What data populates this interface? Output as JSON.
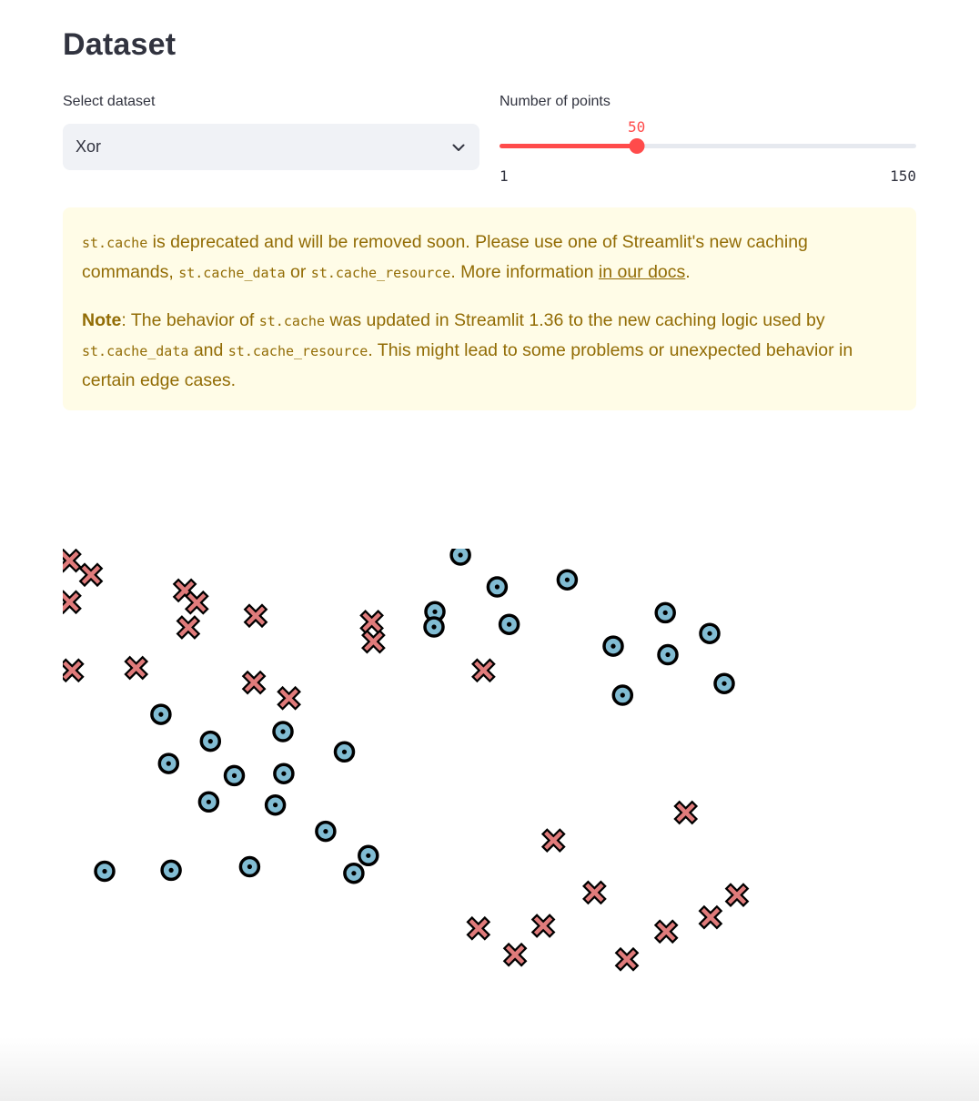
{
  "header": {
    "title": "Dataset"
  },
  "dataset_select": {
    "label": "Select dataset",
    "value": "Xor",
    "icon": "chevron-down-icon"
  },
  "points_slider": {
    "label": "Number of points",
    "value": 50,
    "value_text": "50",
    "min": 1,
    "min_text": "1",
    "max": 150,
    "max_text": "150",
    "accent": "#ff4b4b"
  },
  "warning": {
    "p1": {
      "code1": "st.cache",
      "text1": " is deprecated and will be removed soon. Please use one of Streamlit's new caching commands, ",
      "code2": "st.cache_data",
      "text2": " or ",
      "code3": "st.cache_resource",
      "text3": ". More information ",
      "link": "in our docs",
      "text4": "."
    },
    "p2": {
      "bold": "Note",
      "text1": ": The behavior of ",
      "code1": "st.cache",
      "text2": " was updated in Streamlit 1.36 to the new caching logic used by ",
      "code2": "st.cache_data",
      "text3": " and ",
      "code3": "st.cache_resource",
      "text4": ". This might lead to some problems or unexpected behavior in certain edge cases."
    },
    "colors": {
      "background": "#fffce7",
      "text": "#926c05"
    }
  },
  "chart_data": {
    "type": "scatter",
    "xlim": [
      0,
      100
    ],
    "ylim": [
      0,
      100
    ],
    "grid": false,
    "series": [
      {
        "marker": "x",
        "color": "#e07b7b",
        "points": [
          [
            0.8,
            98.9
          ],
          [
            3.3,
            96.1
          ],
          [
            14.3,
            93.0
          ],
          [
            15.7,
            90.6
          ],
          [
            0.8,
            90.7
          ],
          [
            22.6,
            88.0
          ],
          [
            14.7,
            85.7
          ],
          [
            36.4,
            82.9
          ],
          [
            8.6,
            77.7
          ],
          [
            1.1,
            77.2
          ],
          [
            22.4,
            74.8
          ],
          [
            26.5,
            71.7
          ],
          [
            49.3,
            77.2
          ],
          [
            36.2,
            86.8
          ],
          [
            73.0,
            49.1
          ],
          [
            57.5,
            43.6
          ],
          [
            62.3,
            33.3
          ],
          [
            66.1,
            20.1
          ],
          [
            56.3,
            26.7
          ],
          [
            79.0,
            32.8
          ],
          [
            75.9,
            28.4
          ],
          [
            48.7,
            26.2
          ],
          [
            53.0,
            21.0
          ],
          [
            70.7,
            25.6
          ]
        ]
      },
      {
        "marker": "o",
        "color": "#81bcd3",
        "points": [
          [
            46.6,
            100.0
          ],
          [
            50.9,
            93.7
          ],
          [
            59.1,
            95.1
          ],
          [
            43.6,
            88.8
          ],
          [
            43.5,
            85.8
          ],
          [
            52.3,
            86.3
          ],
          [
            70.6,
            88.6
          ],
          [
            75.8,
            84.5
          ],
          [
            64.5,
            82.0
          ],
          [
            70.9,
            80.3
          ],
          [
            65.6,
            72.3
          ],
          [
            77.5,
            74.6
          ],
          [
            11.5,
            68.5
          ],
          [
            17.3,
            63.2
          ],
          [
            25.8,
            65.1
          ],
          [
            33.0,
            61.1
          ],
          [
            12.4,
            58.8
          ],
          [
            20.1,
            56.4
          ],
          [
            25.9,
            56.8
          ],
          [
            17.1,
            51.2
          ],
          [
            24.9,
            50.6
          ],
          [
            30.8,
            45.4
          ],
          [
            35.8,
            40.6
          ],
          [
            4.9,
            37.5
          ],
          [
            12.7,
            37.7
          ],
          [
            21.9,
            38.4
          ],
          [
            34.1,
            37.1
          ]
        ]
      }
    ]
  }
}
